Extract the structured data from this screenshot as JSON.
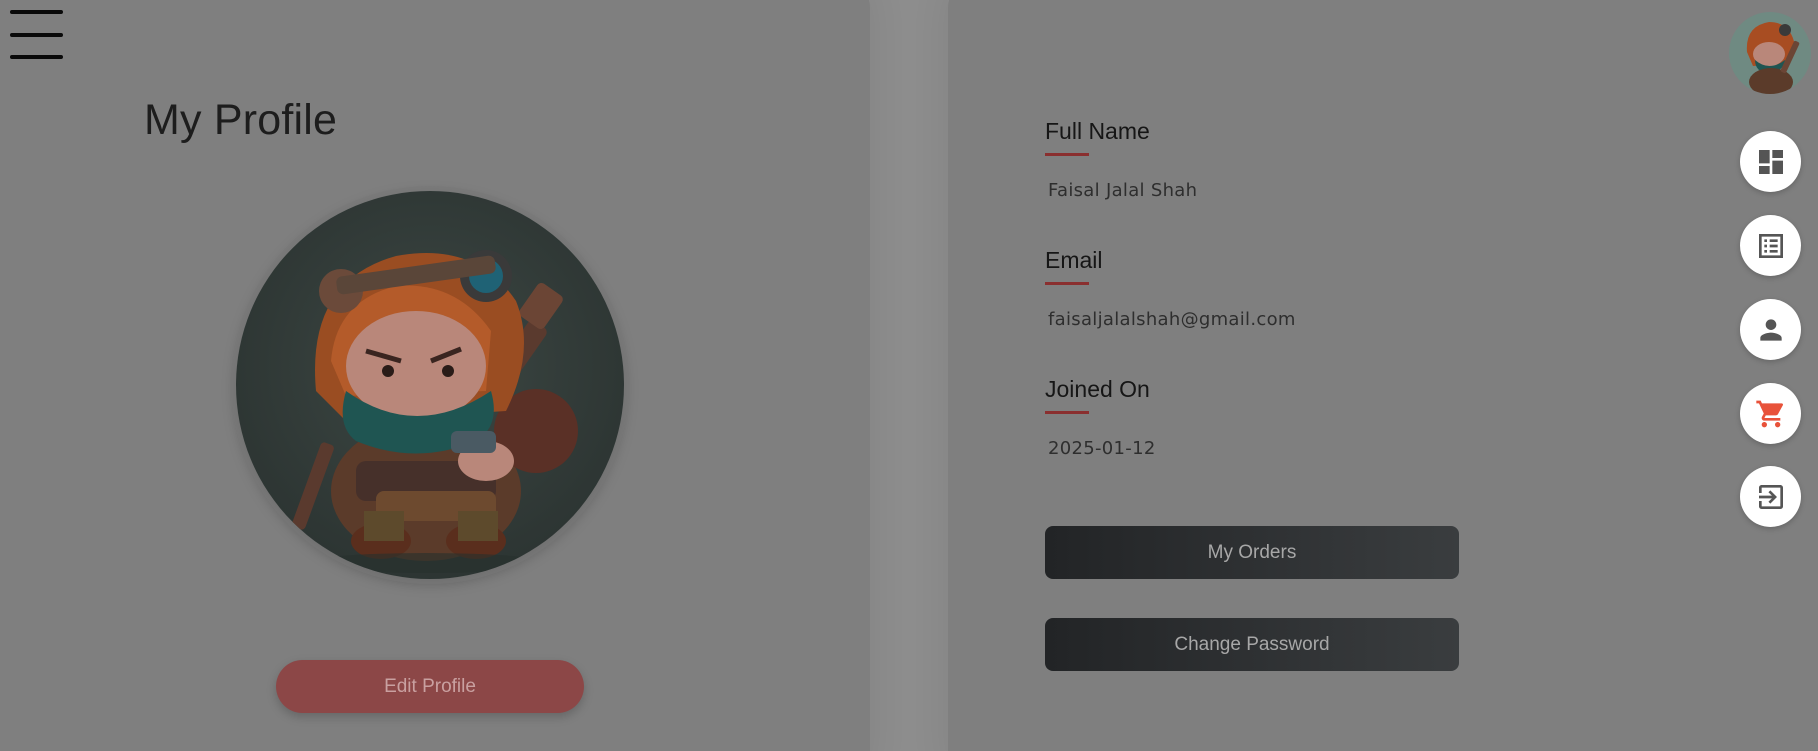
{
  "header": {
    "menu_icon": "hamburger-menu-icon",
    "page_title": "My Profile"
  },
  "profile": {
    "avatar_alt": "profile-avatar",
    "edit_label": "Edit Profile"
  },
  "details": {
    "full_name_label": "Full Name",
    "full_name_value": "Faisal Jalal Shah",
    "email_label": "Email",
    "email_value": "faisaljalalshah@gmail.com",
    "joined_label": "Joined On",
    "joined_value": "2025-01-12"
  },
  "actions": {
    "orders_label": "My Orders",
    "password_label": "Change Password"
  },
  "sidebar": {
    "items": [
      {
        "icon": "dashboard-icon"
      },
      {
        "icon": "list-icon"
      },
      {
        "icon": "person-icon"
      },
      {
        "icon": "cart-icon"
      },
      {
        "icon": "logout-icon"
      }
    ]
  },
  "colors": {
    "accent_red": "#e8523a",
    "underline": "#8a2f2f",
    "edit_button": "#8c4747"
  }
}
